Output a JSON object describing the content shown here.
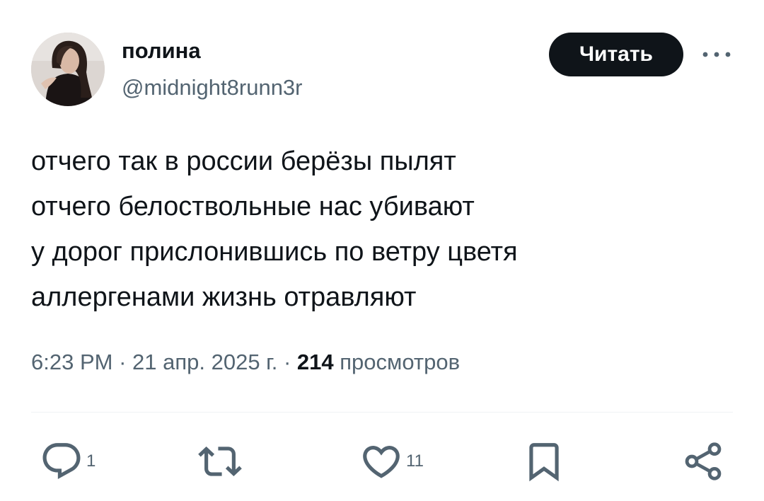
{
  "author": {
    "name": "полина",
    "handle": "@midnight8runn3r"
  },
  "follow_button_label": "Читать",
  "tweet": {
    "lines": [
      "отчего так в россии берёзы пылят",
      "отчего белоствольные нас убивают",
      "у дорог прислонившись по ветру цветя",
      "аллергенами жизнь отравляют"
    ]
  },
  "meta": {
    "time": "6:23 PM",
    "date": "21 апр. 2025 г.",
    "views_count": "214",
    "views_label": "просмотров"
  },
  "actions": {
    "reply": {
      "icon": "reply-icon",
      "count": "1"
    },
    "retweet": {
      "icon": "retweet-icon"
    },
    "like": {
      "icon": "heart-icon",
      "count": "11"
    },
    "bookmark": {
      "icon": "bookmark-icon"
    },
    "share": {
      "icon": "share-icon"
    }
  },
  "colors": {
    "text": "#0f1419",
    "secondary": "#536471",
    "button_bg": "#0f1419",
    "divider": "#eff3f4"
  }
}
